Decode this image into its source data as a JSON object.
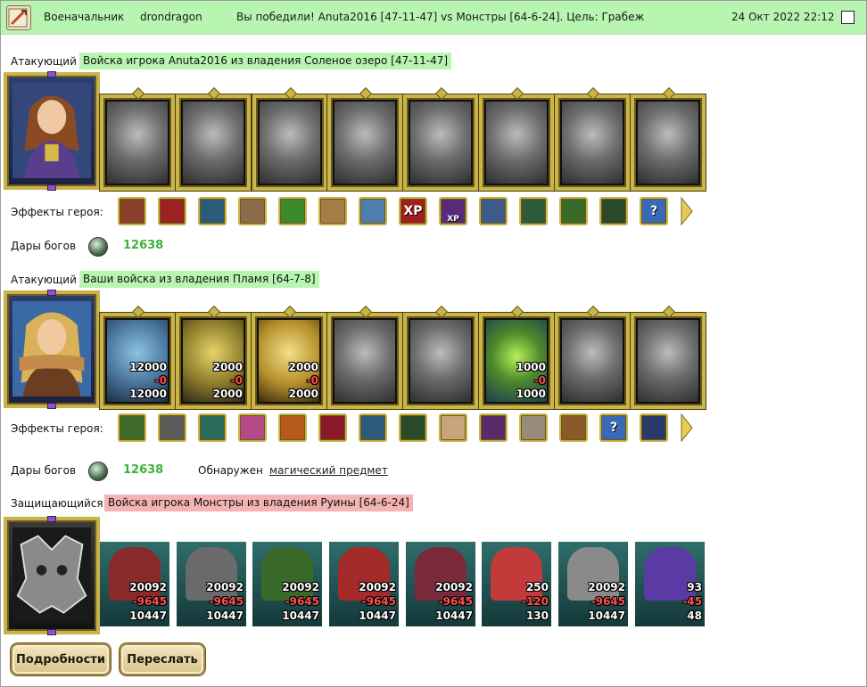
{
  "header": {
    "rank": "Военачальник",
    "player": "drondragon",
    "result": "Вы победили! Anuta2016 [47-11-47] vs Монстры [64-6-24]. Цель: Грабеж",
    "date": "24 Окт 2022 22:12"
  },
  "attacker1": {
    "role": "Атакующий",
    "army": "Войска игрока Anuta2016 из владения Соленое озеро [47-11-47]",
    "effects_label": "Эффекты героя:",
    "gifts_label": "Дары богов",
    "gifts_value": "12638"
  },
  "attacker2": {
    "role": "Атакующий",
    "army": "Ваши войска из владения Пламя [64-7-8]",
    "effects_label": "Эффекты героя:",
    "gifts_label": "Дары богов",
    "gifts_value": "12638",
    "found_label": "Обнаружен",
    "found_item": "магический предмет",
    "troops": [
      {
        "n": "12000",
        "loss": "-0",
        "left": "12000"
      },
      {
        "n": "2000",
        "loss": "-0",
        "left": "2000"
      },
      {
        "n": "2000",
        "loss": "-0",
        "left": "2000"
      },
      {
        "n": "",
        "loss": "",
        "left": ""
      },
      {
        "n": "",
        "loss": "",
        "left": ""
      },
      {
        "n": "1000",
        "loss": "-0",
        "left": "1000"
      },
      {
        "n": "",
        "loss": "",
        "left": ""
      },
      {
        "n": "",
        "loss": "",
        "left": ""
      }
    ]
  },
  "defender": {
    "role": "Защищающийся",
    "army": "Войска игрока Монстры из владения Руины [64-6-24]",
    "troops": [
      {
        "n": "20092",
        "loss": "-9645",
        "left": "10447"
      },
      {
        "n": "20092",
        "loss": "-9645",
        "left": "10447"
      },
      {
        "n": "20092",
        "loss": "-9645",
        "left": "10447"
      },
      {
        "n": "20092",
        "loss": "-9645",
        "left": "10447"
      },
      {
        "n": "20092",
        "loss": "-9645",
        "left": "10447"
      },
      {
        "n": "250",
        "loss": "-120",
        "left": "130"
      },
      {
        "n": "20092",
        "loss": "-9645",
        "left": "10447"
      },
      {
        "n": "93",
        "loss": "-45",
        "left": "48"
      }
    ]
  },
  "effects1": [
    "XP",
    "XP",
    "?"
  ],
  "effects2": [
    "?"
  ],
  "buttons": {
    "details": "Подробности",
    "forward": "Переслать"
  },
  "colors": {
    "header_bg": "#b8f5b0",
    "attacker_chip": "#b8f5b0",
    "defender_chip": "#f5b3b3",
    "gift_value": "#3bb33b",
    "loss": "#ff4a4a"
  }
}
